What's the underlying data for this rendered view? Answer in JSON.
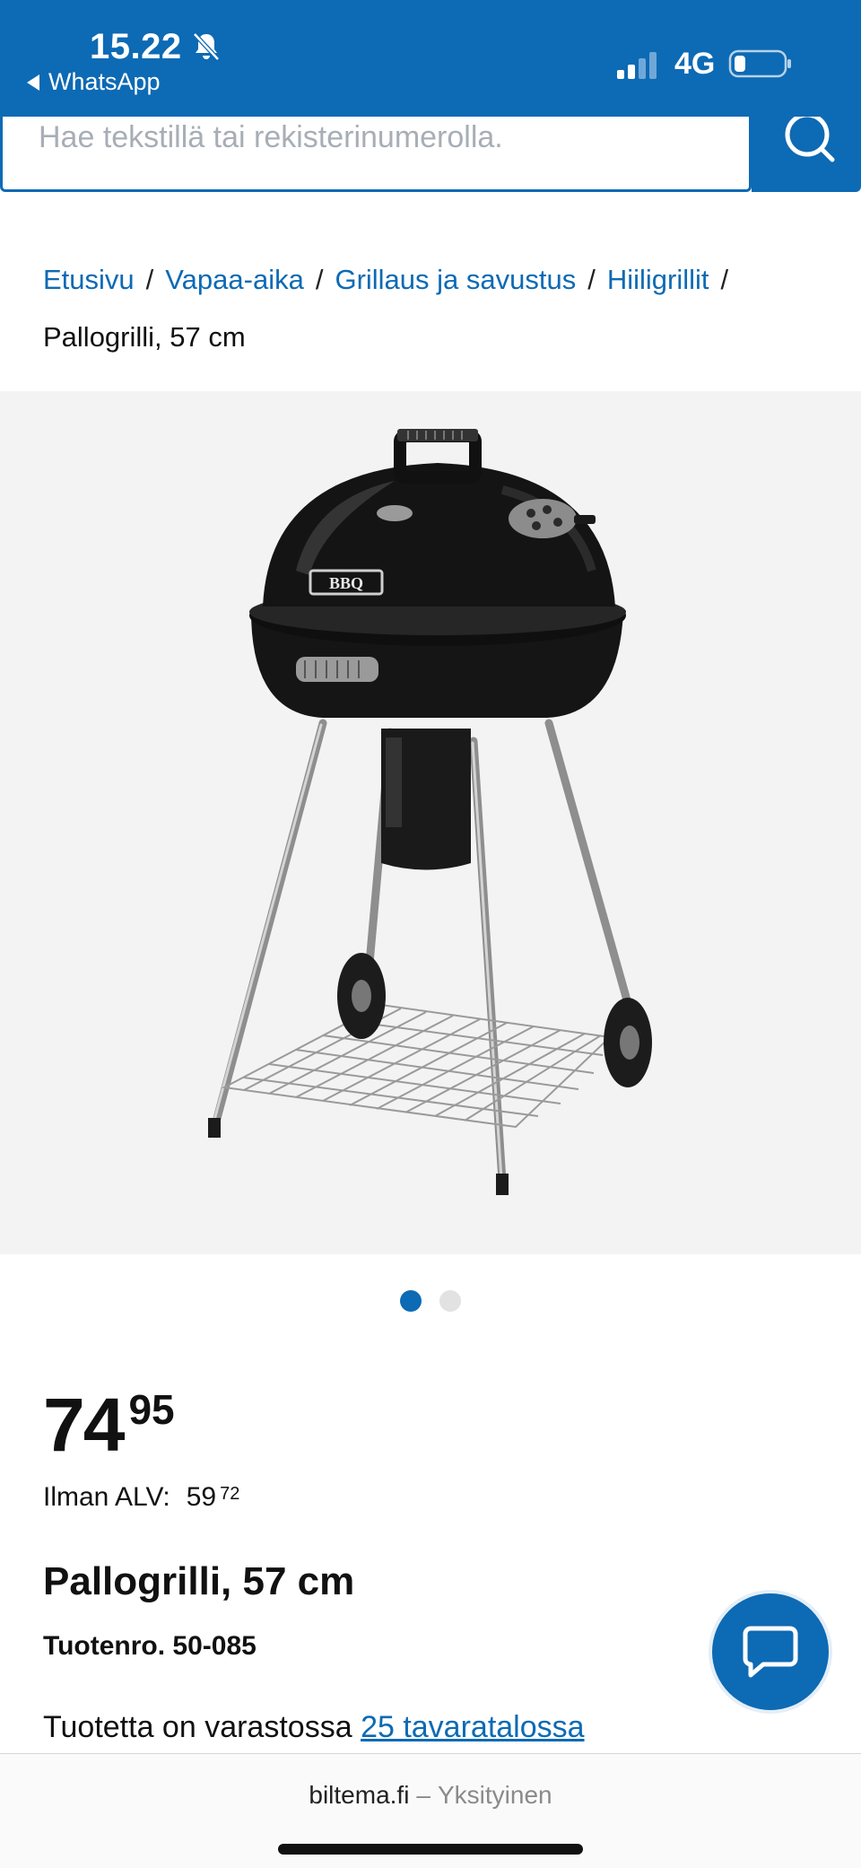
{
  "status_bar": {
    "time": "15.22",
    "back_app": "WhatsApp",
    "network": "4G"
  },
  "search": {
    "placeholder": "Hae tekstillä tai rekisterinumerolla."
  },
  "breadcrumb": {
    "items": [
      "Etusivu",
      "Vapaa-aika",
      "Grillaus ja savustus",
      "Hiiligrillit"
    ],
    "current": "Pallogrilli, 57 cm",
    "separator": "/"
  },
  "product": {
    "image_logo_text": "BBQ",
    "carousel": {
      "count": 2,
      "active": 1
    },
    "price_main": "74",
    "price_cents": "95",
    "vat_label": "Ilman ALV:",
    "vat_main": "59",
    "vat_cents": "72",
    "title": "Pallogrilli, 57 cm",
    "sku": "Tuotenro. 50-085",
    "stock_text": "Tuotetta on varastossa",
    "stock_link": "25 tavaratalossa"
  },
  "browser": {
    "domain": "biltema.fi",
    "dash": "–",
    "mode": "Yksityinen"
  },
  "colors": {
    "brand_blue": "#0d6ab4",
    "image_background": "#f3f3f3"
  },
  "icons": [
    "bell-slash-icon",
    "back-arrow-icon",
    "signal-icon",
    "battery-icon",
    "search-icon",
    "chat-icon"
  ]
}
